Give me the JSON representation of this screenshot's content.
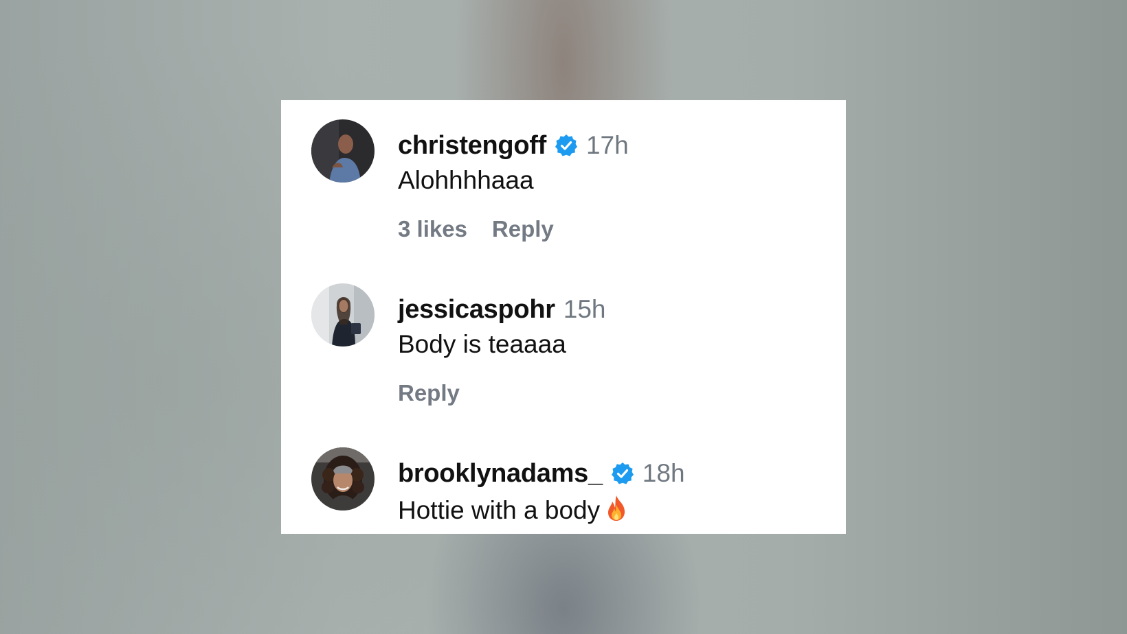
{
  "comments": [
    {
      "username": "christengoff",
      "verified": true,
      "time": "17h",
      "text": "Alohhhhaaa",
      "likes": "3 likes",
      "reply": "Reply"
    },
    {
      "username": "jessicaspohr",
      "verified": false,
      "time": "15h",
      "text": "Body is teaaaa",
      "reply": "Reply"
    },
    {
      "username": "brooklynadams_",
      "verified": true,
      "time": "18h",
      "text": "Hottie with a body",
      "emoji": "fire-emoji"
    }
  ],
  "icons": {
    "verified_badge": "verified-badge-icon",
    "verified_color": "#1d9bf0"
  }
}
